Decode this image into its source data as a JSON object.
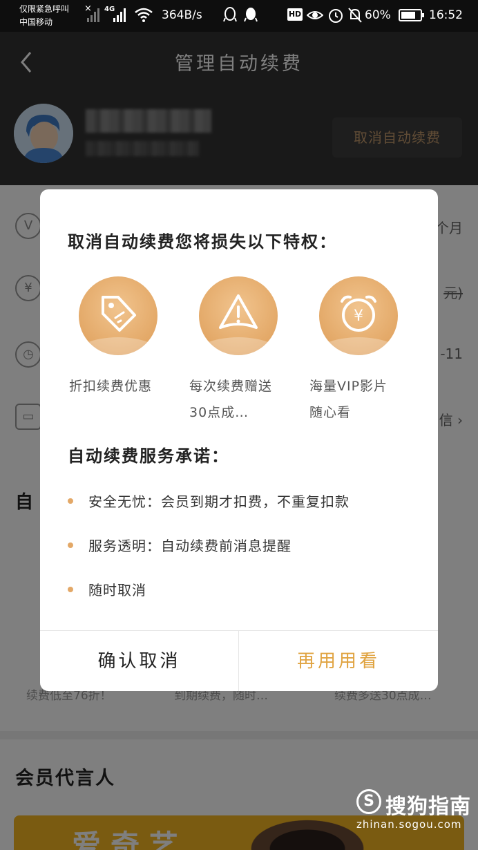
{
  "status_bar": {
    "carrier_line1": "仅限紧急呼叫",
    "carrier_line2": "中国移动",
    "network": "4G",
    "speed": "364B/s",
    "hd": "HD",
    "battery": "60%",
    "time": "16:52"
  },
  "header": {
    "title": "管理自动续费",
    "cancel_auto_renew": "取消自动续费"
  },
  "background": {
    "row1_right": "个月",
    "row2_right": "元)",
    "row3_right": "-11",
    "row4_right": "信 ›",
    "section_char": "自",
    "promo1": "续费低至76折！",
    "promo2": "到期续费，随时…",
    "promo3": "续费多送30点成…",
    "spokesperson_title": "会员代言人",
    "banner_text": "爱奇艺"
  },
  "dialog": {
    "title": "取消自动续费您将损失以下特权：",
    "privileges": [
      {
        "icon": "tag-icon",
        "label": "折扣续费优惠"
      },
      {
        "icon": "gift-icon",
        "label": "每次续费赠送30点成…"
      },
      {
        "icon": "alarm-clock-yen-icon",
        "label": "海量VIP影片随心看"
      }
    ],
    "promise_title": "自动续费服务承诺：",
    "promises": [
      "安全无忧：会员到期才扣费，不重复扣款",
      "服务透明：自动续费前消息提醒",
      "随时取消"
    ],
    "confirm_cancel": "确认取消",
    "keep_using": "再用用看"
  },
  "watermark": {
    "name": "搜狗指南",
    "url": "zhinan.sogou.com"
  },
  "colors": {
    "accent_gold": "#e3a867",
    "keep_button": "#e0a340",
    "header_bg": "#333333"
  }
}
